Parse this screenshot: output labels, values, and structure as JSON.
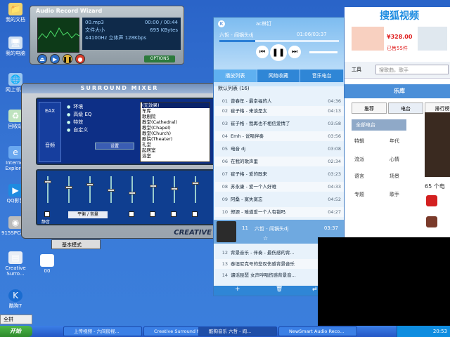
{
  "desktop_icons": [
    {
      "label": "我的文档",
      "icon": "folder-icon"
    },
    {
      "label": "我的电脑",
      "icon": "computer-icon"
    },
    {
      "label": "网上邻居",
      "icon": "network-icon"
    },
    {
      "label": "回收站",
      "icon": "recycle-bin-icon"
    },
    {
      "label": "Internet Explorer",
      "icon": "ie-icon"
    },
    {
      "label": "QQ影音",
      "icon": "qqplayer-icon"
    },
    {
      "label": "915SPCamC",
      "icon": "camera-icon"
    },
    {
      "label": "Creative Surro...",
      "icon": "creative-icon"
    },
    {
      "label": "酷狗7",
      "icon": "kugou-icon"
    },
    {
      "label": "00",
      "icon": "file-icon"
    }
  ],
  "recorder": {
    "title": "Audio Record Wizard",
    "file": "00.mp3",
    "time": "00:00 / 00:44",
    "size_label": "文件大小",
    "size_value": "695 KBytes",
    "rate_label": "44100Hz",
    "stereo": "立体声",
    "bitrate": "128Kbps",
    "options_label": "OPTIONS"
  },
  "mixer": {
    "title": "SURROUND MIXER",
    "eax_label": "EAX",
    "side_label": "音频",
    "options": [
      "环境",
      "高级 EQ",
      "特效",
      "自定义"
    ],
    "set_button": "设置",
    "effects_list": [
      "(无效果)",
      "车库",
      "歌剧院",
      "教堂(Cathedral)",
      "教堂(Chapel)",
      "教堂(Church)",
      "剧院(Theater)",
      "礼堂",
      "起居室",
      "浴室"
    ],
    "mode_label": "基本模式",
    "mute_labels": [
      "静音",
      "静音",
      "静音",
      "静音",
      "静音",
      "静音",
      "静音",
      "静音"
    ],
    "brand": "CREATIVE",
    "lr_label": "平衡 / 音量"
  },
  "player": {
    "username": "ac林钉",
    "current": "六哲 - 阎锅头dj",
    "time": "01:06/03:37",
    "tabs": [
      "播放列表",
      "网络收藏",
      "音乐电台"
    ],
    "list_title": "默认列表 (16)",
    "tracks": [
      {
        "n": "01",
        "t": "曾春年 - 最幸福的人",
        "d": "04:36"
      },
      {
        "n": "02",
        "t": "崔子格 - 来谈是太",
        "d": "04:13"
      },
      {
        "n": "03",
        "t": "崔子格 - 我再也不相信爱情了",
        "d": "03:58"
      },
      {
        "n": "04",
        "t": "Emh - 说唱伴奏",
        "d": "03:56"
      },
      {
        "n": "05",
        "t": "电音 dj",
        "d": "03:08"
      },
      {
        "n": "06",
        "t": "在我的歌声里",
        "d": "02:34"
      },
      {
        "n": "07",
        "t": "崔子格 - 爱的既来",
        "d": "03:23"
      },
      {
        "n": "08",
        "t": "苏永康 - 爱一个人好难",
        "d": "04:33"
      },
      {
        "n": "09",
        "t": "阿桑 - 寞失寞忘",
        "d": "04:52"
      },
      {
        "n": "10",
        "t": "郑源 - 难道爱一个人有错吗",
        "d": "04:27"
      }
    ],
    "now_playing": {
      "n": "11",
      "t": "六哲 - 阎锅头dj",
      "d": "03:37"
    },
    "more": [
      {
        "n": "12",
        "t": "背景音乐 - 伴奏 - 最伤感的背..."
      },
      {
        "n": "13",
        "t": "泰坦尼克号的悲叹伤感背景音乐"
      },
      {
        "n": "14",
        "t": "谴谣琵琶 女声哼唱伤感背景音..."
      }
    ]
  },
  "browser": {
    "logo": "搜狐视频",
    "price": "¥328.00",
    "sold": "已售55件",
    "tools": "工具",
    "search_placeholder": "搜歌曲，歌手",
    "nav": "乐库",
    "subtabs": [
      "推荐",
      "电台",
      "排行榜"
    ],
    "all_label": "全部电台",
    "categories": [
      "特辑",
      "年代",
      "流派",
      "心情",
      "语言",
      "场景",
      "专题",
      "歌手"
    ],
    "count": "65 个电"
  },
  "taskbar": {
    "start": "开始",
    "ime": "全拼",
    "windows": [
      "上传视频 - 六间房视...",
      "Creative Surround M...",
      "酷狗音乐 六哲 - 阎...",
      "NewSmart Audio Reco..."
    ],
    "clock": "20:53"
  }
}
